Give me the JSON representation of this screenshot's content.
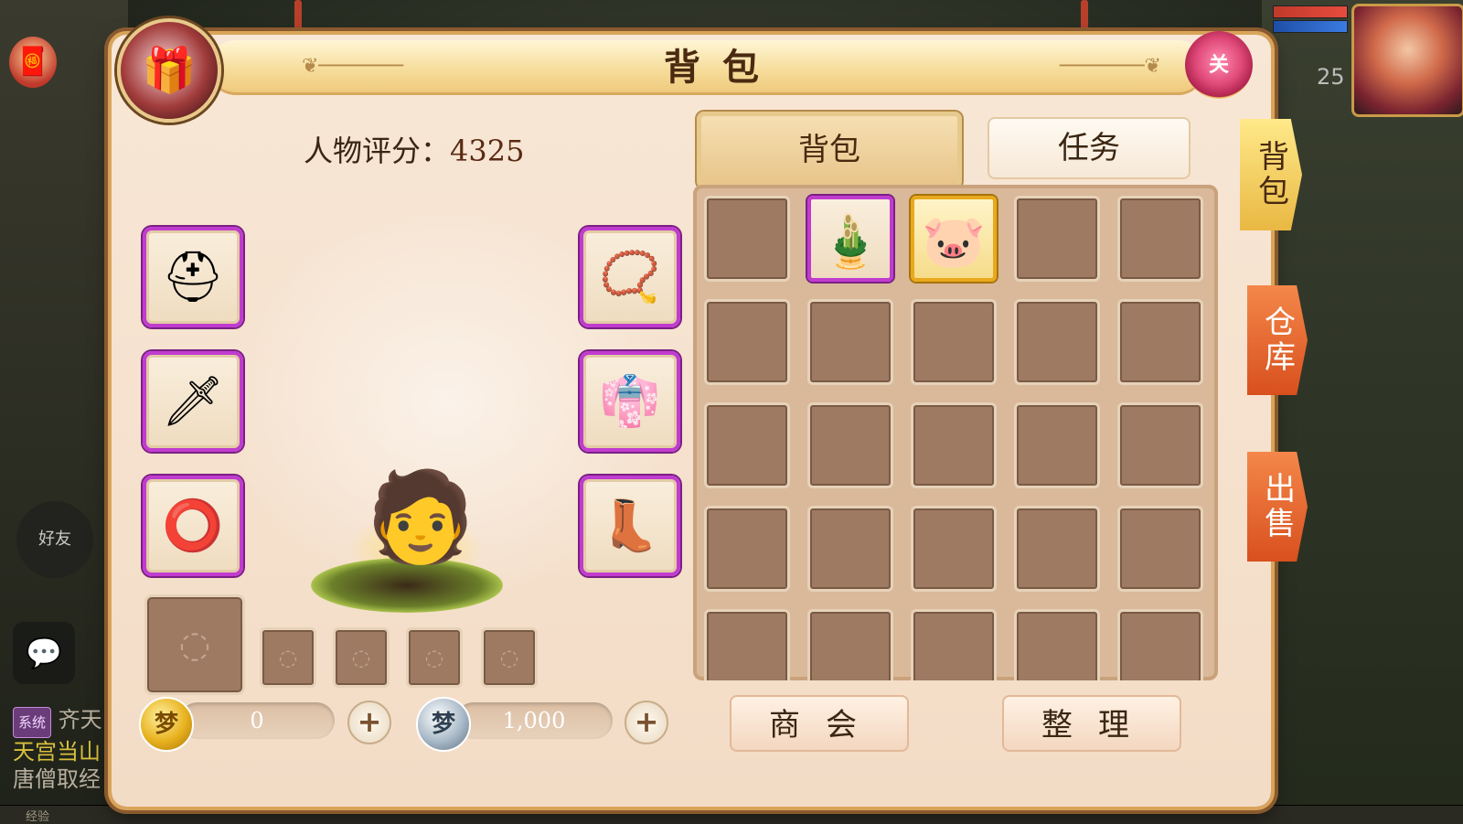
{
  "panel": {
    "title": "背包",
    "close_label": "关",
    "score_label": "人物评分：",
    "score_value": "4325"
  },
  "tabs": [
    {
      "label": "背包",
      "active": true
    },
    {
      "label": "任务",
      "active": false
    }
  ],
  "side_tabs": [
    {
      "label": "背包",
      "active": true
    },
    {
      "label": "仓库",
      "active": false
    },
    {
      "label": "出售",
      "active": false
    }
  ],
  "equipment": {
    "left": [
      {
        "slot": "helmet",
        "icon": "helmet-icon",
        "glyph": "⛑"
      },
      {
        "slot": "weapon",
        "icon": "scimitar-icon",
        "glyph": "🗡"
      },
      {
        "slot": "belt",
        "icon": "jade-belt-icon",
        "glyph": "⭕"
      }
    ],
    "right": [
      {
        "slot": "necklace",
        "icon": "bead-necklace-icon",
        "glyph": "📿"
      },
      {
        "slot": "armor",
        "icon": "robe-icon",
        "glyph": "👘"
      },
      {
        "slot": "boots",
        "icon": "boots-icon",
        "glyph": "👢"
      }
    ]
  },
  "pet_slots": {
    "main_icon": "pet-slot-icon",
    "small_count": 4
  },
  "currency": {
    "gold": {
      "icon": "gold-coin-icon",
      "value": "0"
    },
    "silver": {
      "icon": "silver-coin-icon",
      "value": "1,000"
    }
  },
  "inventory": {
    "columns": 5,
    "rows": 5,
    "items": [
      {
        "index": 1,
        "icon": "bamboo-vase-icon",
        "glyph": "🎍",
        "rarity": "purple"
      },
      {
        "index": 2,
        "icon": "pink-pouch-icon",
        "glyph": "🐷",
        "rarity": "gold"
      }
    ]
  },
  "buttons": {
    "shop": "商会",
    "sort": "整理"
  },
  "hud": {
    "level": "25",
    "portrait_icon": "player-portrait-icon",
    "friend_label": "好友",
    "chat_icon": "chat-bubble-icon",
    "chat_lines": [
      {
        "tag": "系统",
        "text": "齐天"
      },
      {
        "text": "天宫当山"
      },
      {
        "text": "唐僧取经"
      }
    ],
    "exp_label": "经验"
  },
  "colors": {
    "title_bar": "#f6dc9a",
    "purple_rarity": "#c03ccf",
    "gold_rarity": "#e8a91e",
    "side_tab_active": "#e9b843",
    "side_tab_inactive": "#d8501e"
  }
}
